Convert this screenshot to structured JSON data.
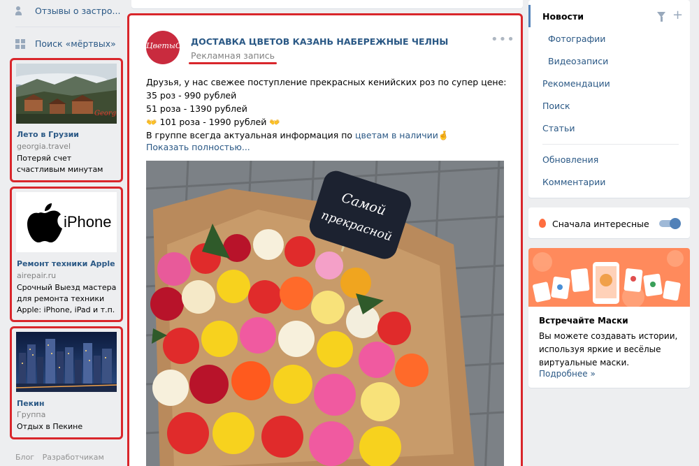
{
  "left_nav": {
    "items": [
      {
        "label": "Отзывы о застро...",
        "icon": "people-icon"
      },
      {
        "label": "Поиск «мёртвых»",
        "icon": "apps-icon"
      }
    ]
  },
  "ads": [
    {
      "title": "Лето в Грузии",
      "domain": "georgia.travel",
      "text": "Потеряй счет счастливым минутам",
      "image": "georgia-landscape"
    },
    {
      "title": "Ремонт техники Apple",
      "domain": "airepair.ru",
      "text": "Срочный Выезд мастера для ремонта техники Apple: iPhone, iPad и т.п.",
      "image": "apple-iphone-logo",
      "logo_text": "iPhone"
    },
    {
      "title": "Пекин",
      "domain": "Группа",
      "text": "Отдых в Пекине",
      "image": "beijing-night-city"
    }
  ],
  "footer": {
    "links": [
      "Блог",
      "Разработчикам"
    ]
  },
  "post": {
    "author": "ДОСТАВКА ЦВЕТОВ КАЗАНЬ НАБЕРЕЖНЫЕ ЧЕЛНЫ",
    "avatar_text": "ЦветыCM",
    "label": "Рекламная запись",
    "more": "•••",
    "lines": [
      "Друзья, у нас свежее поступление прекрасных кенийских роз по супер цене:",
      "35 роз - 990 рублей",
      "51 роза - 1390 рублей",
      "👐 101 роза - 1990 рублей 👐"
    ],
    "last_line_prefix": "В группе всегда актуальная информация по ",
    "hashtag": "цветам в наличии",
    "last_line_suffix": "🤞",
    "show_more": "Показать полностью...",
    "photo_sign": [
      "Самой",
      "прекрасной"
    ]
  },
  "right_menu": {
    "items": [
      {
        "label": "Новости",
        "active": true
      },
      {
        "label": "Фотографии",
        "sub": true
      },
      {
        "label": "Видеозаписи",
        "sub": true
      },
      {
        "label": "Рекомендации"
      },
      {
        "label": "Поиск"
      },
      {
        "label": "Статьи"
      },
      {
        "label": "Обновления"
      },
      {
        "label": "Комментарии"
      }
    ]
  },
  "toggle": {
    "label": "Сначала интересные",
    "on": true
  },
  "masks": {
    "title": "Встречайте Маски",
    "text": "Вы можете создавать истории, используя яркие и весёлые виртуальные маски.",
    "link": "Подробнее »"
  },
  "colors": {
    "accent": "#2a5885",
    "highlight": "#d9262b",
    "background": "#edeef0",
    "masks_banner": "#ff8a5c"
  }
}
